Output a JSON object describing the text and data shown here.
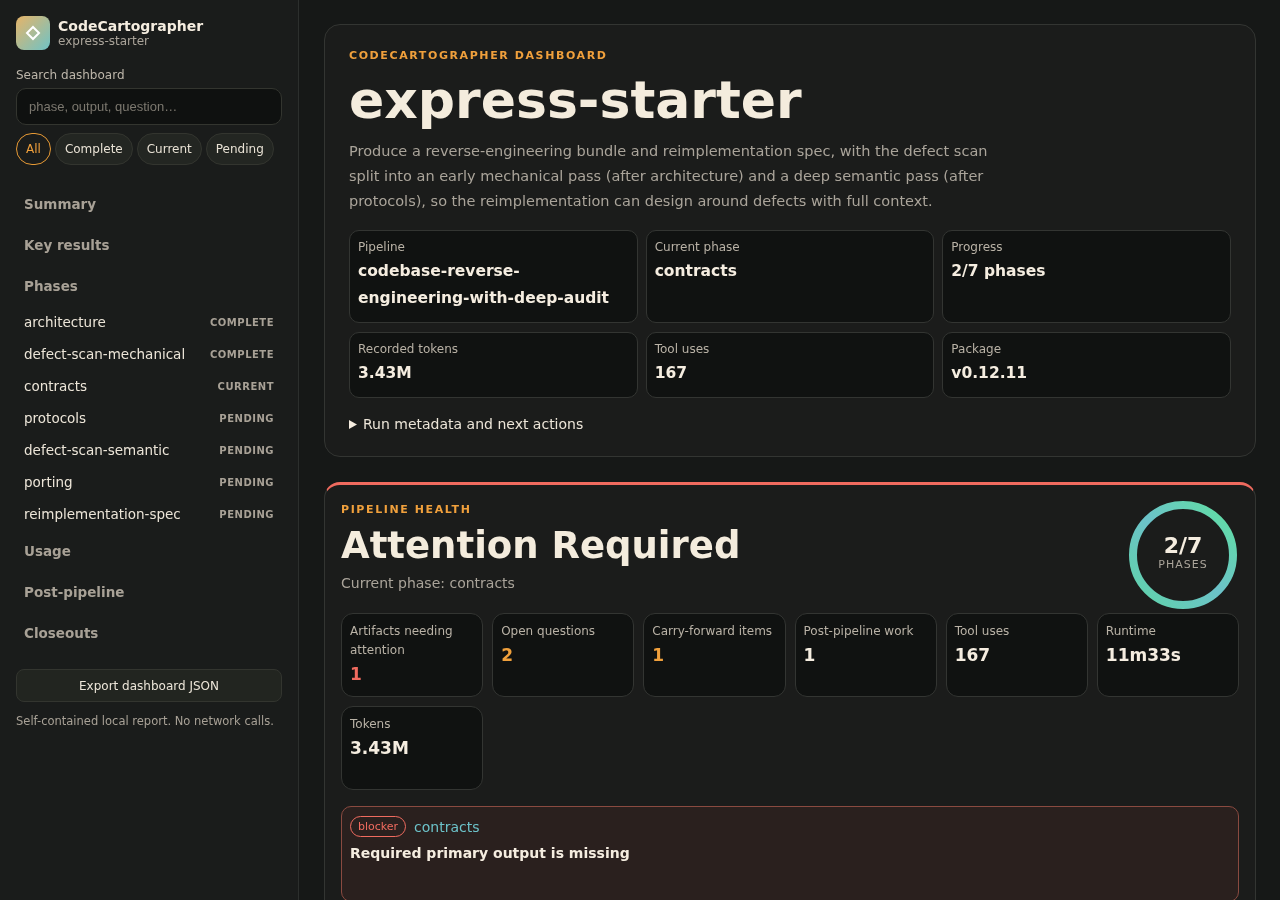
{
  "sidebar": {
    "app_name": "CodeCartographer",
    "project": "express-starter",
    "search": {
      "label": "Search dashboard",
      "placeholder": "phase, output, question…"
    },
    "filters": [
      {
        "label": "All",
        "selected": true
      },
      {
        "label": "Complete",
        "selected": false
      },
      {
        "label": "Current",
        "selected": false
      },
      {
        "label": "Pending",
        "selected": false
      }
    ],
    "nav": [
      {
        "label": "Summary"
      },
      {
        "label": "Key results"
      },
      {
        "label": "Phases",
        "children": [
          {
            "label": "architecture",
            "status": "COMPLETE"
          },
          {
            "label": "defect-scan-mechanical",
            "status": "COMPLETE"
          },
          {
            "label": "contracts",
            "status": "CURRENT"
          },
          {
            "label": "protocols",
            "status": "PENDING"
          },
          {
            "label": "defect-scan-semantic",
            "status": "PENDING"
          },
          {
            "label": "porting",
            "status": "PENDING"
          },
          {
            "label": "reimplementation-spec",
            "status": "PENDING"
          }
        ]
      },
      {
        "label": "Usage"
      },
      {
        "label": "Post-pipeline"
      },
      {
        "label": "Closeouts"
      }
    ],
    "export_button": "Export dashboard JSON",
    "footnote": "Self-contained local report. No network calls."
  },
  "hero": {
    "eyebrow": "CODECARTOGRAPHER DASHBOARD",
    "title": "express-starter",
    "description": "Produce a reverse-engineering bundle and reimplementation spec, with the defect scan split into an early mechanical pass (after architecture) and a deep semantic pass (after protocols), so the reimplementation can design around defects with full context.",
    "facts": [
      {
        "label": "Pipeline",
        "value": "codebase-reverse-engineering-with-deep-audit"
      },
      {
        "label": "Current phase",
        "value": "contracts"
      },
      {
        "label": "Progress",
        "value": "2/7 phases"
      },
      {
        "label": "Recorded tokens",
        "value": "3.43M"
      },
      {
        "label": "Tool uses",
        "value": "167"
      },
      {
        "label": "Package",
        "value": "v0.12.11"
      }
    ],
    "details": {
      "summary": "Run metadata and next actions",
      "expanded": false
    }
  },
  "health": {
    "eyebrow": "PIPELINE HEALTH",
    "title": "Attention Required",
    "subtitle": "Current phase: contracts",
    "ring": {
      "value": "2/7",
      "label": "PHASES"
    },
    "stats": [
      {
        "label": "Artifacts needing attention",
        "value": "1",
        "color": "#f06b5f"
      },
      {
        "label": "Open questions",
        "value": "2",
        "color": "#f0a03c"
      },
      {
        "label": "Carry-forward items",
        "value": "1",
        "color": "#f0a03c"
      },
      {
        "label": "Post-pipeline work",
        "value": "1",
        "color": "#f5ede0"
      },
      {
        "label": "Tool uses",
        "value": "167",
        "color": "#f5ede0"
      },
      {
        "label": "Runtime",
        "value": "11m33s",
        "color": "#f5ede0"
      },
      {
        "label": "Tokens",
        "value": "3.43M",
        "color": "#f5ede0"
      }
    ],
    "issues": [
      {
        "severity": "blocker",
        "phase": "contracts",
        "title": "Required primary output is missing"
      }
    ]
  }
}
